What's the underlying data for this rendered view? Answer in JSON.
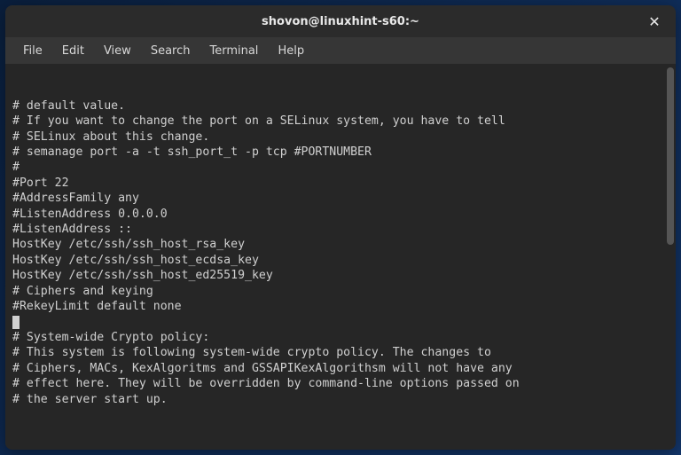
{
  "window": {
    "title": "shovon@linuxhint-s60:~"
  },
  "menubar": {
    "items": [
      "File",
      "Edit",
      "View",
      "Search",
      "Terminal",
      "Help"
    ]
  },
  "terminal": {
    "lines": [
      "# default value.",
      "",
      "# If you want to change the port on a SELinux system, you have to tell",
      "# SELinux about this change.",
      "# semanage port -a -t ssh_port_t -p tcp #PORTNUMBER",
      "#",
      "#Port 22",
      "#AddressFamily any",
      "#ListenAddress 0.0.0.0",
      "#ListenAddress ::",
      "",
      "HostKey /etc/ssh/ssh_host_rsa_key",
      "HostKey /etc/ssh/ssh_host_ecdsa_key",
      "HostKey /etc/ssh/ssh_host_ed25519_key",
      "",
      "# Ciphers and keying",
      "#RekeyLimit default none",
      "",
      "# System-wide Crypto policy:",
      "# This system is following system-wide crypto policy. The changes to",
      "# Ciphers, MACs, KexAlgoritms and GSSAPIKexAlgorithsm will not have any",
      "# effect here. They will be overridden by command-line options passed on",
      "# the server start up."
    ],
    "cursor_line_index": 17
  }
}
